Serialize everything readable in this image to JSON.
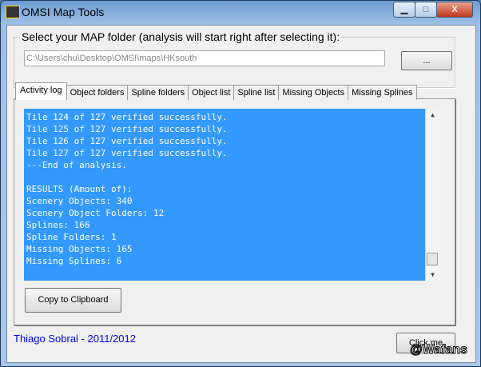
{
  "window": {
    "title": "OMSI Map Tools",
    "min": "▁",
    "max": "□",
    "close": "X"
  },
  "folder": {
    "label": "Select your MAP folder (analysis will start right after selecting it):",
    "path": "C:\\Users\\chu\\Desktop\\OMSI\\maps\\HKsouth",
    "browse": "..."
  },
  "tabs": [
    "Activity log",
    "Object folders",
    "Spline folders",
    "Object list",
    "Spline list",
    "Missing Objects",
    "Missing Splines"
  ],
  "log": [
    "Tile 124 of 127 verified successfully.",
    "Tile 125 of 127 verified successfully.",
    "Tile 126 of 127 verified successfully.",
    "Tile 127 of 127 verified successfully.",
    "---End of analysis.",
    "",
    "RESULTS (Amount of):",
    "Scenery Objects: 340",
    "Scenery Object Folders: 12",
    "Splines: 166",
    "Spline Folders: 1",
    "Missing Objects: 165",
    "Missing Splines: 6"
  ],
  "copy_button": "Copy to Clipboard",
  "footer": "Thiago Sobral - 2011/2012",
  "click_button": "Click me",
  "watermark": "@Wafans"
}
